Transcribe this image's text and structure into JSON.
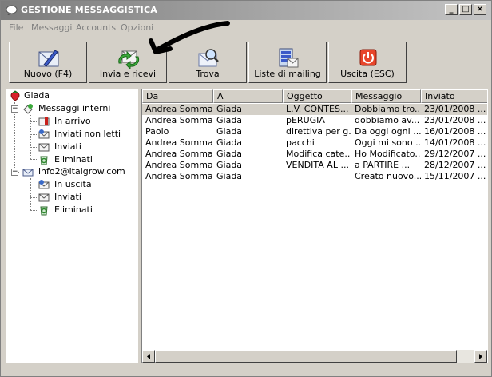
{
  "window": {
    "title": "GESTIONE MESSAGGISTICA",
    "controls": [
      "_",
      "□",
      "×"
    ]
  },
  "menu": [
    "File",
    "Messaggi",
    "Accounts",
    "Opzioni"
  ],
  "toolbar": [
    {
      "label": "Nuovo (F4)",
      "icon": "new-message-icon"
    },
    {
      "label": "Invia e ricevi",
      "icon": "send-receive-icon"
    },
    {
      "label": "Trova",
      "icon": "find-icon"
    },
    {
      "label": "Liste di mailing",
      "icon": "mailing-list-icon"
    },
    {
      "label": "Uscita (ESC)",
      "icon": "exit-icon"
    }
  ],
  "tree": {
    "root": "Giada",
    "groups": [
      {
        "label": "Messaggi interni",
        "children": [
          "In arrivo",
          "Inviati non letti",
          "Inviati",
          "Eliminati"
        ]
      },
      {
        "label": "info2@italgrow.com",
        "children": [
          "In uscita",
          "Inviati",
          "Eliminati"
        ]
      }
    ]
  },
  "table": {
    "columns": [
      "Da",
      "A",
      "Oggetto",
      "Messaggio",
      "Inviato"
    ],
    "rows": [
      [
        "Andrea Somma...",
        "Giada",
        "L.V. CONTES...",
        "Dobbiamo tro...",
        "23/01/2008 ..."
      ],
      [
        "Andrea Somma...",
        "Giada",
        "pERUGIA",
        "dobbiamo av...",
        "23/01/2008 ..."
      ],
      [
        "Paolo",
        "Giada",
        "direttiva per g...",
        "Da oggi ogni ...",
        "16/01/2008 ..."
      ],
      [
        "Andrea Somma...",
        "Giada",
        "pacchi",
        "Oggi mi sono ...",
        "14/01/2008 ..."
      ],
      [
        "Andrea Somma...",
        "Giada",
        "Modifica cate...",
        "Ho Modificato...",
        "29/12/2007 ..."
      ],
      [
        "Andrea Somma...",
        "Giada",
        "VENDITA AL ...",
        "a PARTIRE ...",
        "28/12/2007 ..."
      ],
      [
        "Andrea Somma...",
        "Giada",
        "",
        "Creato nuovo...",
        "15/11/2007 ..."
      ]
    ],
    "selected_row": 0
  }
}
